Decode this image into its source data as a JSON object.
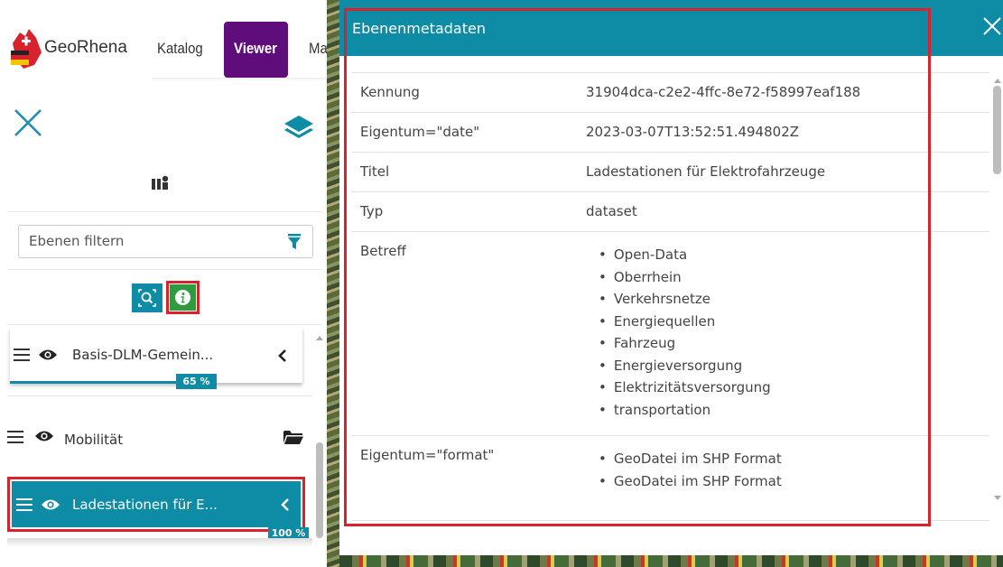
{
  "header": {
    "brand": "GeoRhena",
    "tabs": [
      {
        "label": "Katalog"
      },
      {
        "label": "Viewer"
      },
      {
        "label": "Maps"
      }
    ]
  },
  "sidebar": {
    "filter_placeholder": "Ebenen filtern",
    "layers": [
      {
        "label": "Basis-DLM-Gemein...",
        "progress_percent": 65,
        "progress_label": "65 %"
      },
      {
        "label": "Mobilität"
      },
      {
        "label": "Ladestationen für E...",
        "progress_percent": 100,
        "progress_label": "100 %",
        "selected": true
      }
    ]
  },
  "dialog": {
    "title": "Ebenenmetadaten",
    "rows": [
      {
        "key": "Kennung",
        "value": "31904dca-c2e2-4ffc-8e72-f58997eaf188"
      },
      {
        "key": "Eigentum=\"date\"",
        "value": "2023-03-07T13:52:51.494802Z"
      },
      {
        "key": "Titel",
        "value": "Ladestationen für Elektrofahrzeuge"
      },
      {
        "key": "Typ",
        "value": "dataset"
      },
      {
        "key": "Betreff",
        "values": [
          "Open-Data",
          "Oberrhein",
          "Verkehrsnetze",
          "Energiequellen",
          "Fahrzeug",
          "Energieversorgung",
          "Elektrizitätsversorgung",
          "transportation"
        ]
      },
      {
        "key": "Eigentum=\"format\"",
        "values": [
          "GeoDatei im SHP Format",
          "GeoDatei im SHP Format"
        ]
      }
    ]
  },
  "colors": {
    "accent": "#0e8ba5",
    "viewer_tab": "#600d7c",
    "info_button": "#2e9c3e",
    "highlight": "#d8232f"
  }
}
